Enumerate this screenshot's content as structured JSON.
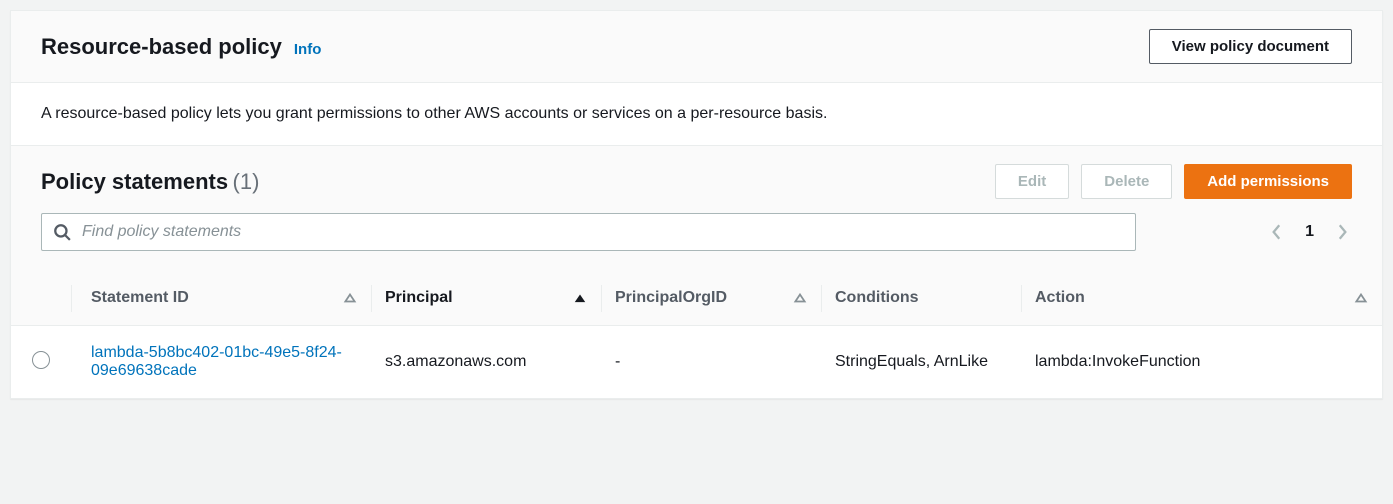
{
  "header": {
    "title": "Resource-based policy",
    "info_link": "Info",
    "view_button": "View policy document"
  },
  "description": "A resource-based policy lets you grant permissions to other AWS accounts or services on a per-resource basis.",
  "statements": {
    "title": "Policy statements",
    "count": "(1)",
    "edit_label": "Edit",
    "delete_label": "Delete",
    "add_label": "Add permissions",
    "search_placeholder": "Find policy statements",
    "page": "1"
  },
  "columns": {
    "statement_id": "Statement ID",
    "principal": "Principal",
    "principal_org_id": "PrincipalOrgID",
    "conditions": "Conditions",
    "action": "Action"
  },
  "rows": [
    {
      "statement_id": "lambda-5b8bc402-01bc-49e5-8f24-09e69638cade",
      "principal": "s3.amazonaws.com",
      "principal_org_id": "-",
      "conditions": "StringEquals, ArnLike",
      "action": "lambda:InvokeFunction"
    }
  ]
}
